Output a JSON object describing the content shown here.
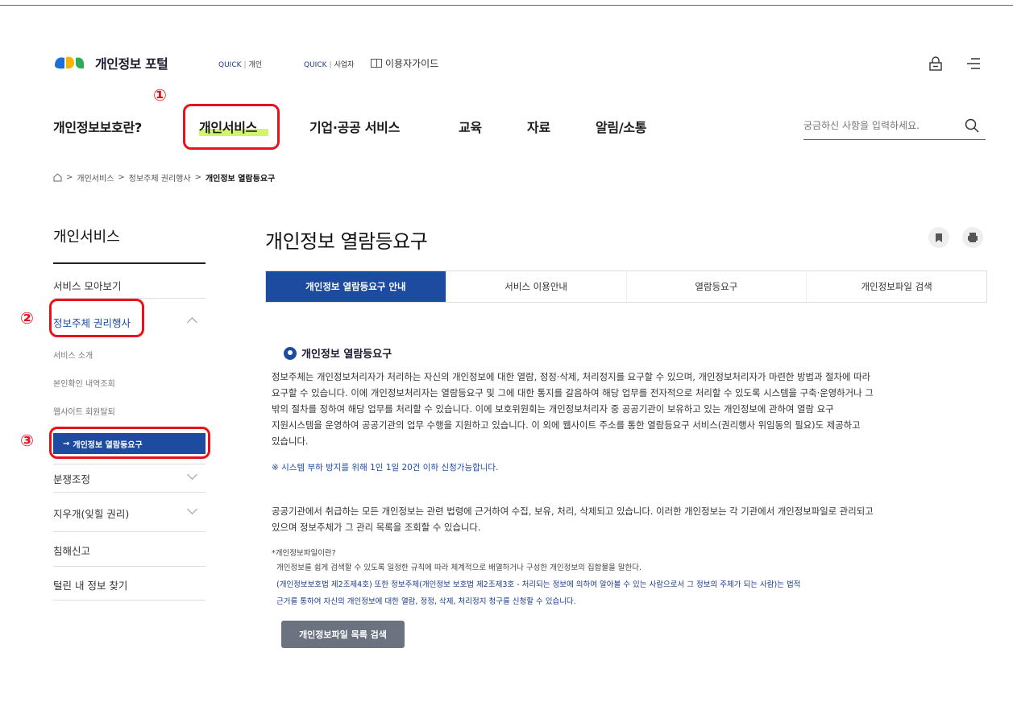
{
  "header": {
    "logo_text": "개인정보 포털",
    "quick_individual": {
      "tag": "QUICK",
      "label": "개인"
    },
    "quick_business": {
      "tag": "QUICK",
      "label": "사업자"
    },
    "guide_label": "이용자가이드"
  },
  "gnb": {
    "items": [
      "개인정보보호란?",
      "개인서비스",
      "기업·공공 서비스",
      "교육",
      "자료",
      "알림/소통"
    ],
    "search_placeholder": "궁금하신 사항을 입력하세요."
  },
  "breadcrumb": [
    "개인서비스",
    "정보주체 권리행사",
    "개인정보 열람등요구"
  ],
  "annotations": [
    "①",
    "②",
    "③"
  ],
  "sidebar": {
    "title": "개인서비스",
    "items": [
      "서비스 모아보기",
      "정보주체 권리행사",
      "분쟁조정",
      "지우개(잊힐 권리)",
      "침해신고",
      "털린 내 정보 찾기"
    ],
    "sub_items": [
      "서비스 소개",
      "본인확인 내역조회",
      "웹사이트 회원탈퇴",
      "개인정보 열람등요구"
    ]
  },
  "main": {
    "title": "개인정보 열람등요구",
    "tabs": [
      "개인정보 열람등요구 안내",
      "서비스 이용안내",
      "열람등요구",
      "개인정보파일 검색"
    ],
    "section_title": "개인정보 열람등요구",
    "para1": [
      "정보주체는 개인정보처리자가 처리하는 자신의 개인정보에 대한 열람, 정정·삭제, 처리정지를 요구할 수 있으며, 개인정보처리자가 마련한 방법과 절차에 따라",
      "요구할 수 있습니다. 이에 개인정보처리자는 열람등요구 및 그에 대한 통지를 갈음하여 해당 업무를 전자적으로 처리할 수 있도록 시스템을 구축·운영하거나 그",
      "밖의 절차를 정하여 해당 업무를 처리할 수 있습니다. 이에 보호위원회는 개인정보처리자 중 공공기관이 보유하고 있는 개인정보에 관하여 열람 요구",
      "지원시스템을 운영하여 공공기관의 업무 수행을 지원하고 있습니다. 이 외에 웹사이트 주소를 통한 열람등요구 서비스(권리행사 위임동의 필요)도 제공하고",
      "있습니다."
    ],
    "note": "※ 시스템 부하 방지를 위해 1인 1일 20건 이하 신청가능합니다.",
    "para2": [
      "공공기관에서 취급하는 모든 개인정보는 관련 법령에 근거하여 수집, 보유, 처리, 삭제되고 있습니다. 이러한 개인정보는 각 기관에서 개인정보파일로 관리되고",
      "있으며 정보주체가 그 관리 목록을 조회할 수 있습니다."
    ],
    "def_title": "*개인정보파일이란?",
    "def_lines": [
      "개인정보를 쉽게 검색할 수 있도록 일정한 규칙에 따라 체계적으로 배열하거나 구성한 개인정보의 집합물을 말한다.",
      "(개인정보보호법 제2조제4호) 또한 정보주체(개인정보 보호법 제2조제3호 - 처리되는 정보에 의하여 알아볼 수 있는 사람으로서 그 정보의 주체가 되는 사람)는 법적",
      "근거를 통하여 자신의 개인정보에 대한 열람, 정정, 삭제, 처리정지 청구를 신청할 수 있습니다."
    ],
    "button": "개인정보파일 목록 검색"
  },
  "colors": {
    "primary": "#1d4ba0",
    "highlight": "#d2f56a",
    "annotation_red": "#e8121c",
    "button_gray": "#6b7280"
  }
}
